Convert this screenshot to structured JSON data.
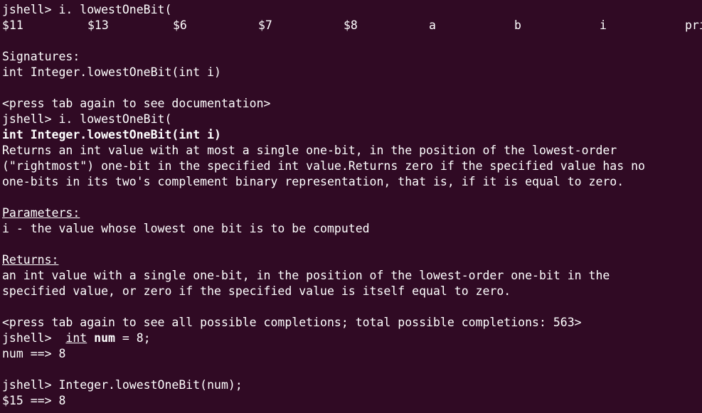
{
  "colors": {
    "background": "#300a24",
    "foreground": "#ffffff"
  },
  "terminal": {
    "prompt1": "jshell> i. lowestOneBit(",
    "completions": [
      "$11",
      "$13",
      "$6",
      "$7",
      "$8",
      "a",
      "b",
      "i",
      "pri"
    ],
    "signatures_header": "Signatures:",
    "signature": "int Integer.lowestOneBit(int i)",
    "hint_documentation": "<press tab again to see documentation>",
    "prompt2": "jshell> i. lowestOneBit(",
    "doc_signature": "int Integer.lowestOneBit(int i)",
    "doc_line1": "Returns an int value with at most a single one-bit, in the position of the lowest-order",
    "doc_line2": "(\"rightmost\") one-bit in the specified int value.Returns zero if the specified value has no",
    "doc_line3": "one-bits in its two's complement binary representation, that is, if it is equal to zero.",
    "parameters_header": "Parameters:",
    "parameter_i": "i - the value whose lowest one bit is to be computed",
    "returns_header": "Returns:",
    "returns_line1": "an int value with a single one-bit, in the position of the lowest-order one-bit in the",
    "returns_line2": "specified value, or zero if the specified value is itself equal to zero.",
    "hint_completions": "<press tab again to see all possible completions; total possible completions: 563>",
    "prompt3_prefix": "jshell>  ",
    "prompt3_type": "int",
    "prompt3_var": "num",
    "prompt3_rest": " = 8;",
    "result_num": "num ==> 8",
    "prompt4": "jshell> Integer.lowestOneBit(num);",
    "result_15": "$15 ==> 8"
  }
}
